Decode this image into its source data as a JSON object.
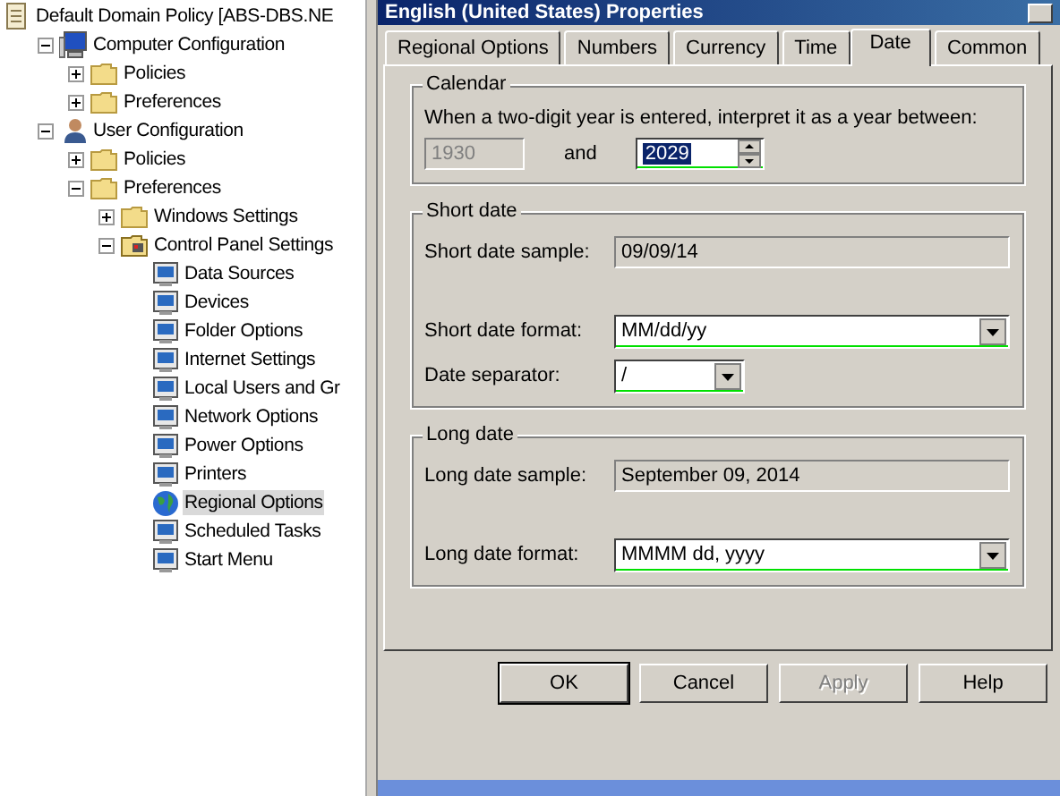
{
  "tree": [
    {
      "label": "Default Domain Policy [ABS-DBS.NE",
      "kind": "scroll",
      "selected": false,
      "children": [
        {
          "label": "Computer Configuration",
          "kind": "computer",
          "expanded": true,
          "selected": false,
          "children": [
            {
              "label": "Policies",
              "kind": "folder",
              "expanded": false,
              "selected": false
            },
            {
              "label": "Preferences",
              "kind": "folder",
              "expanded": false,
              "selected": false
            }
          ]
        },
        {
          "label": "User Configuration",
          "kind": "user",
          "expanded": true,
          "selected": false,
          "children": [
            {
              "label": "Policies",
              "kind": "folder",
              "expanded": false,
              "selected": false
            },
            {
              "label": "Preferences",
              "kind": "folder",
              "expanded": true,
              "selected": false,
              "children": [
                {
                  "label": "Windows Settings",
                  "kind": "folder",
                  "expanded": false,
                  "selected": false
                },
                {
                  "label": "Control Panel Settings",
                  "kind": "cpfolder",
                  "expanded": true,
                  "selected": false,
                  "children": [
                    {
                      "label": "Data Sources",
                      "kind": "applet",
                      "selected": false
                    },
                    {
                      "label": "Devices",
                      "kind": "applet",
                      "selected": false
                    },
                    {
                      "label": "Folder Options",
                      "kind": "applet",
                      "selected": false
                    },
                    {
                      "label": "Internet Settings",
                      "kind": "applet",
                      "selected": false
                    },
                    {
                      "label": "Local Users and Gr",
                      "kind": "applet",
                      "selected": false
                    },
                    {
                      "label": "Network Options",
                      "kind": "applet",
                      "selected": false
                    },
                    {
                      "label": "Power Options",
                      "kind": "applet",
                      "selected": false
                    },
                    {
                      "label": "Printers",
                      "kind": "applet",
                      "selected": false
                    },
                    {
                      "label": "Regional Options",
                      "kind": "globe",
                      "selected": true
                    },
                    {
                      "label": "Scheduled Tasks",
                      "kind": "applet",
                      "selected": false
                    },
                    {
                      "label": "Start Menu",
                      "kind": "applet",
                      "selected": false
                    }
                  ]
                }
              ]
            }
          ]
        }
      ]
    }
  ],
  "dialog": {
    "title": "English (United States) Properties",
    "tabs": [
      {
        "label": "Regional Options",
        "selected": false
      },
      {
        "label": "Numbers",
        "selected": false
      },
      {
        "label": "Currency",
        "selected": false
      },
      {
        "label": "Time",
        "selected": false
      },
      {
        "label": "Date",
        "selected": true
      },
      {
        "label": "Common",
        "selected": false
      }
    ],
    "calendar": {
      "title": "Calendar",
      "prompt": "When a two-digit year is entered, interpret it as a year between:",
      "from": {
        "value": "1930",
        "disabled": true
      },
      "and_label": "and",
      "to": {
        "value": "2029",
        "enabled": true
      }
    },
    "groups": [
      {
        "title": "Short date",
        "sample_label": "Short date sample:",
        "sample": "09/09/14",
        "rows": [
          {
            "label": "Short date format:",
            "value": "MM/dd/yy",
            "kind": "wide",
            "enabled": true
          },
          {
            "label": "Date separator:",
            "value": "/",
            "kind": "narrow",
            "enabled": true
          }
        ]
      },
      {
        "title": "Long date",
        "sample_label": "Long date sample:",
        "sample": "September 09, 2014",
        "rows": [
          {
            "label": "Long date format:",
            "value": "MMMM dd, yyyy",
            "kind": "wide",
            "enabled": true
          }
        ]
      }
    ],
    "buttons": [
      {
        "label": "OK",
        "disabled": false,
        "default": true
      },
      {
        "label": "Cancel",
        "disabled": false,
        "default": false
      },
      {
        "label": "Apply",
        "disabled": true,
        "default": false
      },
      {
        "label": "Help",
        "disabled": false,
        "default": false
      }
    ]
  }
}
